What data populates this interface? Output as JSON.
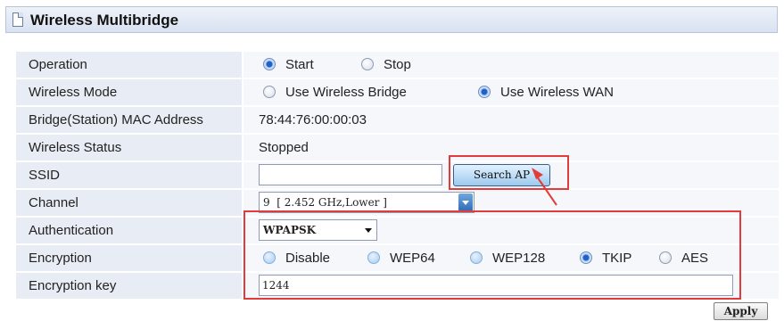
{
  "header": {
    "title": "Wireless Multibridge",
    "icon": "page-icon"
  },
  "rows": {
    "operation": {
      "label": "Operation",
      "options": [
        "Start",
        "Stop"
      ],
      "selected": "Start"
    },
    "wireless_mode": {
      "label": "Wireless Mode",
      "options": [
        "Use Wireless Bridge",
        "Use Wireless WAN"
      ],
      "selected": "Use Wireless WAN"
    },
    "mac": {
      "label": "Bridge(Station) MAC Address",
      "value": "78:44:76:00:00:03"
    },
    "status": {
      "label": "Wireless Status",
      "value": "Stopped"
    },
    "ssid": {
      "label": "SSID",
      "value": "",
      "button": "Search AP"
    },
    "channel": {
      "label": "Channel",
      "value": "9  [ 2.452 GHz,Lower ]"
    },
    "authentication": {
      "label": "Authentication",
      "value": "WPAPSK"
    },
    "encryption": {
      "label": "Encryption",
      "options": [
        "Disable",
        "WEP64",
        "WEP128",
        "TKIP",
        "AES"
      ],
      "selected": "TKIP"
    },
    "encryption_key": {
      "label": "Encryption key",
      "value": "1244"
    }
  },
  "apply_label": "Apply",
  "colors": {
    "highlight": "#e23b3b",
    "label_bg": "#e8edf5",
    "header_bg": "#d9e2f1"
  }
}
